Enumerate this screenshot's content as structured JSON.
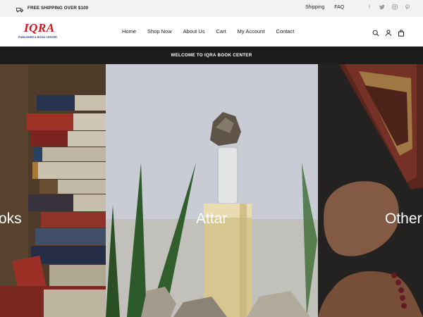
{
  "topbar": {
    "shipping_text": "FREE SHIPPING OVER $100",
    "links": [
      "Shipping",
      "FAQ"
    ],
    "social_icons": [
      "facebook-icon",
      "twitter-icon",
      "instagram-icon",
      "pinterest-icon"
    ]
  },
  "header": {
    "logo_main": "IQRA",
    "logo_sub": "PUBLISHER & BOOK CENTER",
    "nav": [
      "Home",
      "Shop Now",
      "About Us",
      "Cart",
      "My Account",
      "Contact"
    ],
    "icons": [
      "search-icon",
      "user-icon",
      "bag-icon"
    ]
  },
  "announcement": {
    "text": "WELCOME TO IQRA BOOK CENTER"
  },
  "collections": [
    {
      "label": "oks"
    },
    {
      "label": "Attar"
    },
    {
      "label": "Other"
    }
  ],
  "colors": {
    "topbar_bg": "#f2f2f2",
    "announce_bg": "#1c1c1c",
    "logo_red": "#c8181e",
    "logo_blue": "#1f2f8c"
  }
}
